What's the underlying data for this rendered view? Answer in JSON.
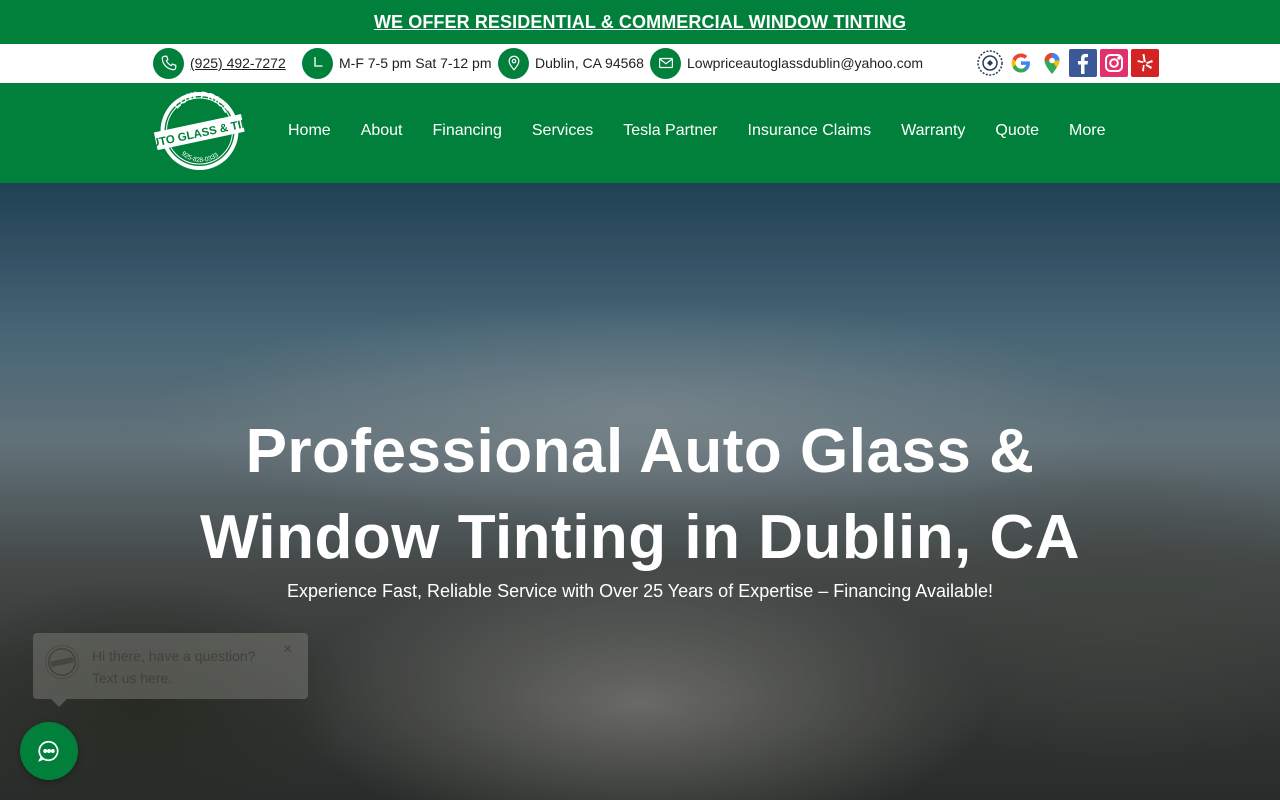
{
  "banner": {
    "text": "WE OFFER RESIDENTIAL & COMMERCIAL WINDOW TINTING"
  },
  "contact": {
    "phone": "(925) 492-7272",
    "hours": "M-F 7-5 pm Sat 7-12 pm",
    "location": "Dublin, CA 94568",
    "email": "Lowpriceautoglassdublin@yahoo.com"
  },
  "social": [
    {
      "icon": "badge-icon"
    },
    {
      "icon": "google-icon"
    },
    {
      "icon": "google-maps-icon"
    },
    {
      "icon": "facebook-icon"
    },
    {
      "icon": "instagram-icon"
    },
    {
      "icon": "yelp-icon"
    }
  ],
  "logo": {
    "line1": "LOW PRICE",
    "line2": "AUTO GLASS & TINT",
    "phone": "925-828-0333"
  },
  "nav": {
    "items": [
      "Home",
      "About",
      "Financing",
      "Services",
      "Tesla Partner",
      "Insurance Claims",
      "Warranty",
      "Quote",
      "More"
    ]
  },
  "hero": {
    "title_line1": "Professional Auto Glass &",
    "title_line2": "Window Tinting in Dublin, CA",
    "subtitle": "Experience Fast, Reliable Service with Over 25 Years of Expertise – Financing Available!"
  },
  "chat": {
    "line1": "Hi there, have a question?",
    "line2": "Text us here.",
    "close": "×"
  },
  "colors": {
    "brand_green": "#00803a",
    "white": "#ffffff"
  }
}
